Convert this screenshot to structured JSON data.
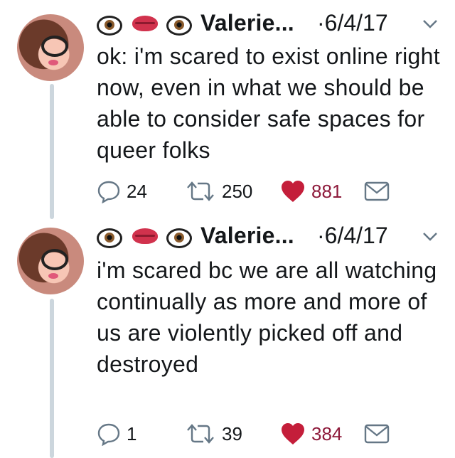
{
  "tweets": [
    {
      "author_name": "Valerie...",
      "date": "·6/4/17",
      "header_emoji": [
        "eye-icon",
        "kiss-mark-icon",
        "eye-icon"
      ],
      "text": "ok: i'm scared to exist online right now, even in what we should be able to consider safe spaces for queer folks",
      "replies": "24",
      "retweets": "250",
      "likes": "881"
    },
    {
      "author_name": "Valerie...",
      "date": "·6/4/17",
      "header_emoji": [
        "eye-icon",
        "kiss-mark-icon",
        "eye-icon"
      ],
      "text": "i'm scared bc we are all watching continually as more and more of us are violently picked off and destroyed",
      "replies": "1",
      "retweets": "39",
      "likes": "384"
    }
  ],
  "colors": {
    "like": "#c41e3a",
    "icon": "#657786",
    "thread": "#ccd6dd"
  }
}
